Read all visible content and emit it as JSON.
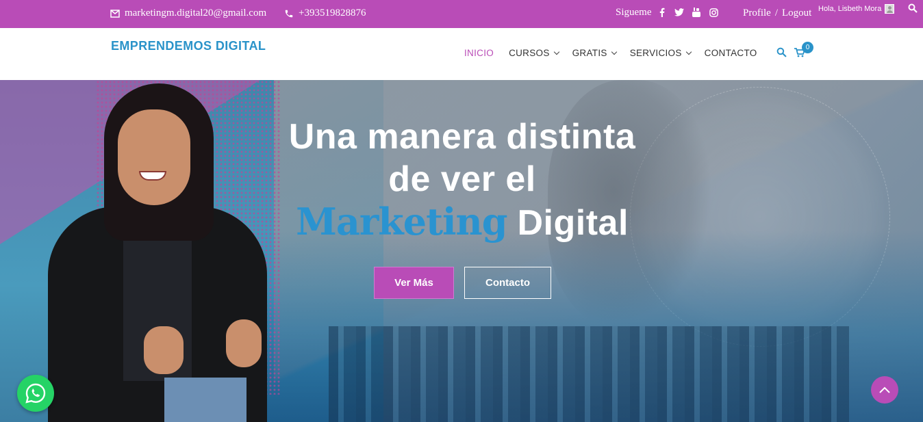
{
  "topbar": {
    "email": "marketingm.digital20@gmail.com",
    "phone": "+393519828876",
    "sigueme": "Sigueme",
    "profile": "Profile",
    "separator": "/",
    "logout": "Logout",
    "greeting": "Hola, Lisbeth Mora",
    "socials": [
      "facebook-icon",
      "twitter-icon",
      "youtube-icon",
      "instagram-icon"
    ]
  },
  "header": {
    "logo": "EMPRENDEMOS DIGITAL",
    "nav": [
      {
        "label": "INICIO",
        "active": true
      },
      {
        "label": "CURSOS",
        "dropdown": true
      },
      {
        "label": "GRATIS",
        "dropdown": true
      },
      {
        "label": "SERVICIOS",
        "dropdown": true
      },
      {
        "label": "CONTACTO"
      }
    ],
    "cart_count": "0"
  },
  "hero": {
    "line1": "Una manera distinta",
    "line2": "de ver el",
    "highlight": "Marketing",
    "line3_rest": "Digital",
    "primary_button": "Ver Más",
    "secondary_button": "Contacto"
  },
  "colors": {
    "brand_purple": "#b94cb7",
    "brand_blue": "#2a93c9",
    "whatsapp_green": "#25d366"
  }
}
